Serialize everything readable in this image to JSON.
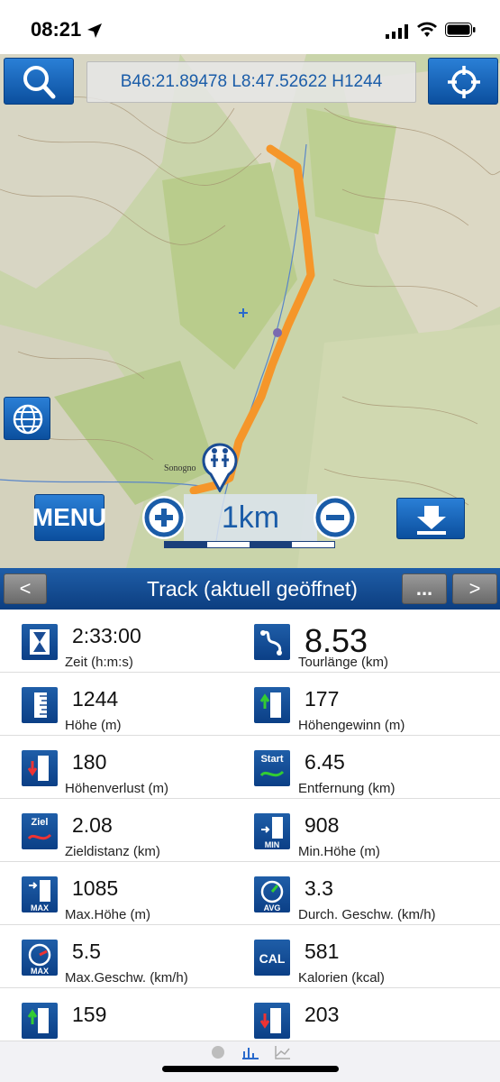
{
  "status": {
    "time": "08:21"
  },
  "map": {
    "coordinates": "B46:21.89478 L8:47.52622 H1244",
    "menu_label": "MENU",
    "zoom_label": "1km",
    "place_label": "Sonogno"
  },
  "track": {
    "title": "Track (aktuell geöffnet)",
    "prev_label": "<",
    "more_label": "...",
    "next_label": ">"
  },
  "stats": [
    {
      "value": "2:33:00",
      "label": "Zeit (h:m:s)",
      "icon": "hourglass-icon"
    },
    {
      "value": "8.53",
      "label": "Tourlänge (km)",
      "icon": "route-length-icon"
    },
    {
      "value": "1244",
      "label": "Höhe (m)",
      "icon": "altitude-icon"
    },
    {
      "value": "177",
      "label": "Höhengewinn (m)",
      "icon": "altitude-gain-icon"
    },
    {
      "value": "180",
      "label": "Höhenverlust (m)",
      "icon": "altitude-loss-icon"
    },
    {
      "value": "6.45",
      "label": "Entfernung (km)",
      "icon": "distance-start-icon",
      "icon_text": "Start"
    },
    {
      "value": "2.08",
      "label": "Zieldistanz (km)",
      "icon": "distance-goal-icon",
      "icon_text": "Ziel"
    },
    {
      "value": "908",
      "label": "Min.Höhe (m)",
      "icon": "min-altitude-icon",
      "icon_text": "MIN"
    },
    {
      "value": "1085",
      "label": "Max.Höhe (m)",
      "icon": "max-altitude-icon",
      "icon_text": "MAX"
    },
    {
      "value": "3.3",
      "label": "Durch. Geschw. (km/h)",
      "icon": "avg-speed-icon",
      "icon_text": "AVG"
    },
    {
      "value": "5.5",
      "label": "Max.Geschw. (km/h)",
      "icon": "max-speed-icon",
      "icon_text": "MAX"
    },
    {
      "value": "581",
      "label": "Kalorien (kcal)",
      "icon": "calories-icon",
      "icon_text": "CAL"
    },
    {
      "value": "159",
      "label": "",
      "icon": "altitude-gain-icon"
    },
    {
      "value": "203",
      "label": "",
      "icon": "altitude-loss-icon"
    }
  ],
  "colors": {
    "accent": "#0c3e80",
    "track": "#f5962a",
    "map_bg": "#c6d3a5"
  }
}
